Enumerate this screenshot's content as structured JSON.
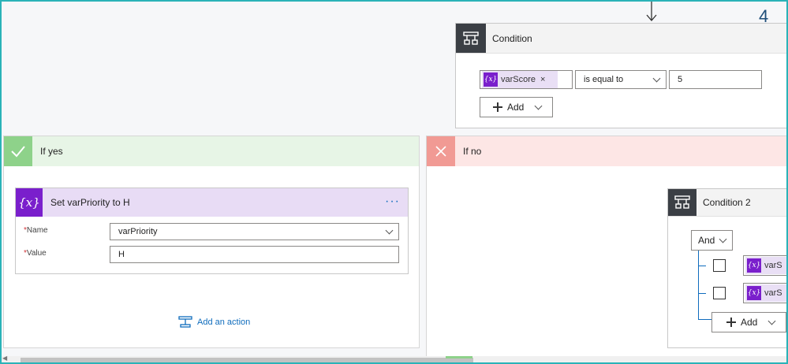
{
  "step_number": "4",
  "colors": {
    "border_frame": "#2ab3b8",
    "condition_header": "#3b3f45",
    "variable_purple": "#7a1fcc",
    "variable_header_bg": "#e8dcf5",
    "yes_green": "#8ed28a",
    "yes_bg": "#e7f5e6",
    "no_red": "#f19a94",
    "no_bg": "#fde6e5",
    "link_blue": "#0f6cbd"
  },
  "condition": {
    "title": "Condition",
    "token_label": "varScore",
    "operator": "is equal to",
    "value": "5",
    "add_label": "Add"
  },
  "if_yes": {
    "title": "If yes",
    "action": {
      "title": "Set varPriority to H",
      "more_icon": "ellipsis-icon",
      "name_label": "Name",
      "name_value": "varPriority",
      "value_label": "Value",
      "value_value": "H",
      "required_mark": "*"
    },
    "add_action_label": "Add an action"
  },
  "if_no": {
    "title": "If no",
    "condition2": {
      "title": "Condition 2",
      "group_operator": "And",
      "rows": [
        {
          "token_label": "varS"
        },
        {
          "token_label": "varS"
        }
      ],
      "add_label": "Add"
    }
  }
}
